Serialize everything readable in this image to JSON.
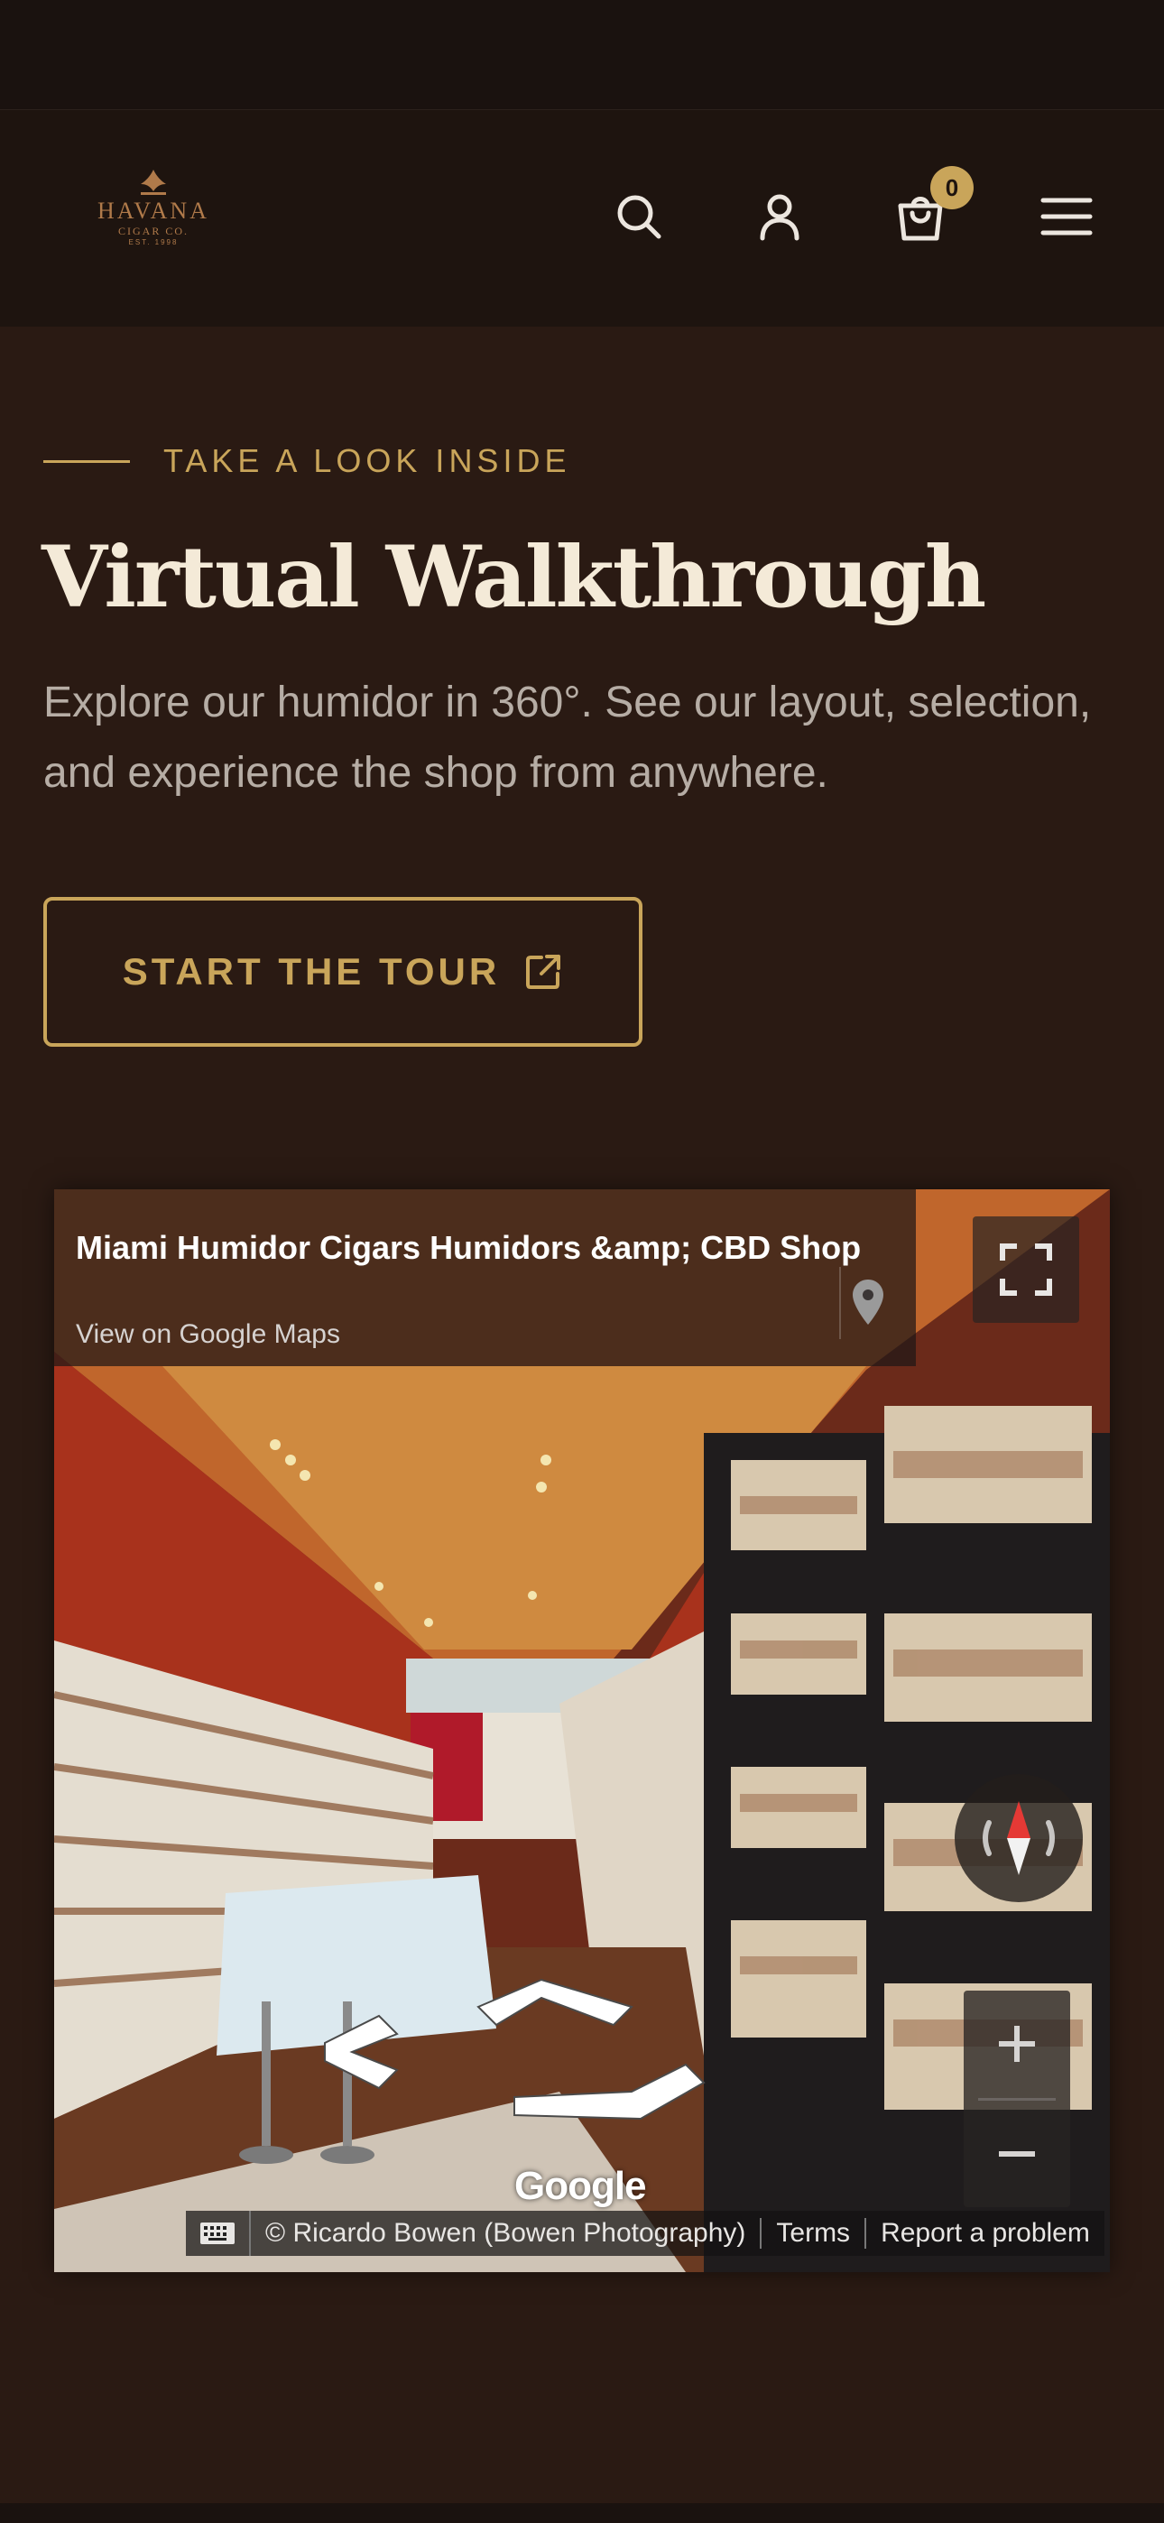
{
  "header": {
    "logo_line1": "HAVANA",
    "logo_line2": "CIGAR CO.",
    "logo_line3": "EST. 1998",
    "cart_count": "0",
    "icons": [
      "search-icon",
      "user-icon",
      "shopping-bag-icon",
      "menu-icon"
    ]
  },
  "section": {
    "eyebrow": "TAKE A LOOK INSIDE",
    "title": "Virtual Walkthrough",
    "description": "Explore our humidor in 360°. See our layout, selection, and experience the shop from anywhere.",
    "cta_label": "START THE TOUR"
  },
  "map": {
    "place_name": "Miami Humidor Cigars Humidors &amp; CBD Shop",
    "view_link": "View on Google Maps",
    "logo_text": "Google",
    "attribution": "© Ricardo Bowen (Bowen Photography)",
    "terms": "Terms",
    "report": "Report a problem"
  },
  "colors": {
    "accent": "#c9a55a",
    "background": "#2a1a13",
    "header_bg": "#1e140f",
    "title": "#f4ead8"
  }
}
